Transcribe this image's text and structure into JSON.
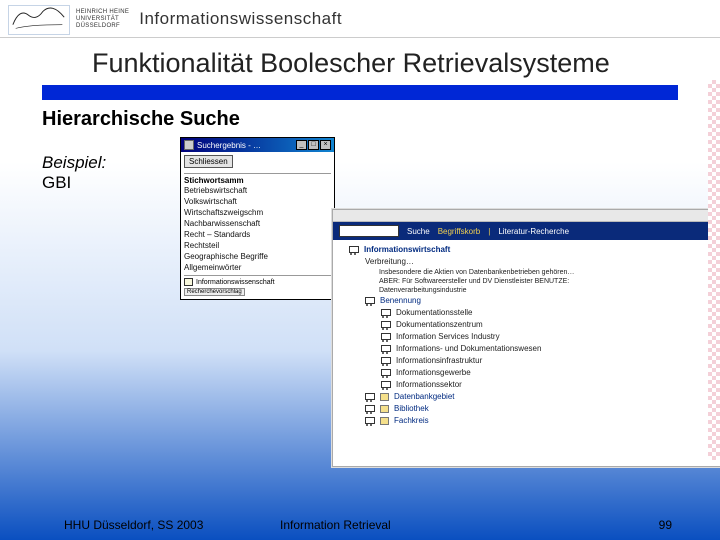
{
  "header": {
    "uni_line1": "HEINRICH HEINE",
    "uni_line2": "UNIVERSITÄT",
    "uni_line3": "DÜSSELDORF",
    "department": "Informationswissenschaft"
  },
  "title": "Funktionalität Boolescher Retrievalsysteme",
  "subtitle": "Hierarchische Suche",
  "example": {
    "label": "Beispiel:",
    "name": "GBI"
  },
  "popup": {
    "window_title": "Suchergebnis - …",
    "btn_min": "_",
    "btn_max": "□",
    "btn_close": "×",
    "close_btn": "Schliessen",
    "category_header": "Stichwortsamm",
    "categories": [
      "Betriebswirtschaft",
      "Volkswirtschaft",
      "Wirtschaftszweigschm",
      "Nachbarwissenschaft",
      "Recht – Standards",
      "Rechtsteil",
      "Geographische Begriffe",
      "Allgemeinwörter"
    ],
    "cart_term": "Informationswissenschaft",
    "mini_button": "Recherchevorschlag"
  },
  "browser": {
    "nav_label": "Suche",
    "nav_link1": "Begriffskorb",
    "nav_sep": "|",
    "nav_link2": "Literatur-Recherche",
    "head_term": "Informationswirtschaft",
    "line1": "Verbreitung…",
    "definition1": "Insbesondere die Aktien von Datenbankenbetrieben gehören…",
    "definition2": "ABER: Für Softwareersteller und DV Dienstleister BENUTZE:",
    "definition3": "Datenverarbeitungsindustrie",
    "subhead": "Benennung",
    "subitems": [
      "Dokumentationsstelle",
      "Dokumentationszentrum",
      "Information Services Industry",
      "Informations- und Dokumentationswesen",
      "Informationsinfrastruktur",
      "Informationsgewerbe",
      "Informationssektor"
    ],
    "branches": [
      "Datenbankgebiet",
      "Bibliothek",
      "Fachkreis"
    ]
  },
  "footer": {
    "left": "HHU Düsseldorf, SS 2003",
    "center": "Information Retrieval",
    "right": "99"
  }
}
